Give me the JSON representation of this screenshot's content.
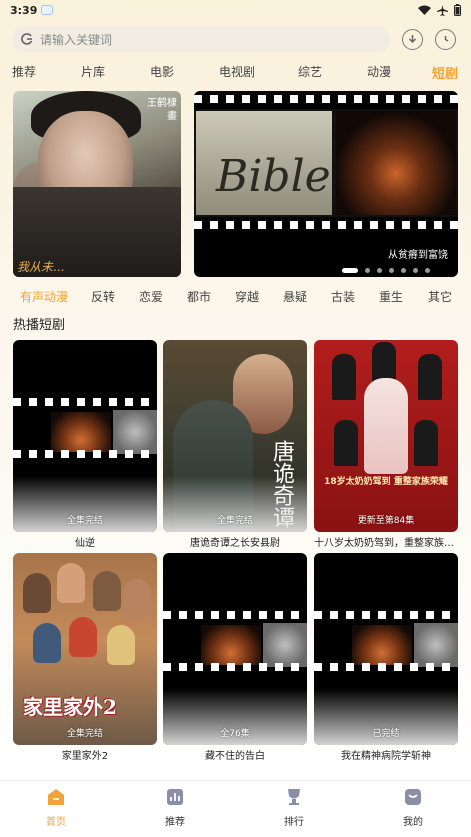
{
  "status_bar": {
    "time": "3:39"
  },
  "search": {
    "placeholder": "请输入关键词"
  },
  "top_tabs": [
    {
      "label": "推荐"
    },
    {
      "label": "片库"
    },
    {
      "label": "电影"
    },
    {
      "label": "电视剧"
    },
    {
      "label": "综艺"
    },
    {
      "label": "动漫"
    },
    {
      "label": "短剧",
      "active": true
    }
  ],
  "banners": [
    {
      "tag_line1": "王鹤棣",
      "tag_line2": "畫",
      "script": "我从未...",
      "caption": ""
    },
    {
      "text": "Bible",
      "caption": "从贫瘠到富饶"
    }
  ],
  "genre_tabs": [
    {
      "label": "有声动漫",
      "active": true
    },
    {
      "label": "反转"
    },
    {
      "label": "恋爱"
    },
    {
      "label": "都市"
    },
    {
      "label": "穿越"
    },
    {
      "label": "悬疑"
    },
    {
      "label": "古装"
    },
    {
      "label": "重生"
    },
    {
      "label": "其它"
    }
  ],
  "section": {
    "title": "热播短剧"
  },
  "cards": [
    {
      "title": "仙逆",
      "badge": "全集完结"
    },
    {
      "title": "唐诡奇谭之长安县尉",
      "badge": "全集完结",
      "poster_text": "唐诡奇谭"
    },
    {
      "title": "十八岁太奶奶驾到，重整家族荣耀",
      "badge": "更新至第84集",
      "poster_text": "18岁太奶奶驾到 重整家族荣耀"
    },
    {
      "title": "家里家外2",
      "badge": "全集完结",
      "poster_text": "家里家外2"
    },
    {
      "title": "藏不住的告白",
      "badge": "全76集"
    },
    {
      "title": "我在精神病院学斩神",
      "badge": "已完结"
    }
  ],
  "bottom_nav": [
    {
      "label": "首页",
      "active": true
    },
    {
      "label": "推荐"
    },
    {
      "label": "排行"
    },
    {
      "label": "我的"
    }
  ],
  "colors": {
    "accent": "#f0a43a"
  }
}
